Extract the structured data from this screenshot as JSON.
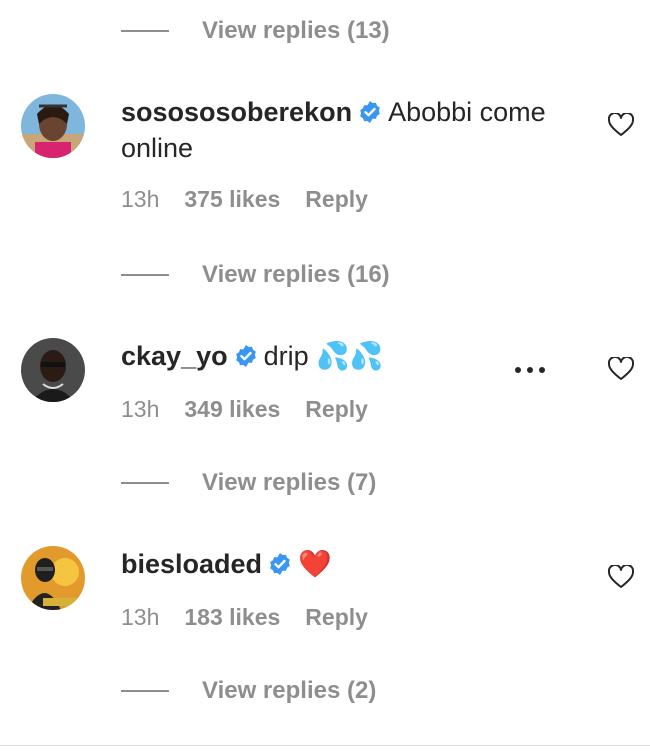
{
  "top_view_replies": {
    "label": "View replies (13)"
  },
  "comments": [
    {
      "username": "sosososoberekon",
      "text": "Abobbi come online",
      "time": "13h",
      "likes": "375 likes",
      "reply_label": "Reply",
      "view_replies": "View replies (16)"
    },
    {
      "username": "ckay_yo",
      "text": "drip 💦💦",
      "time": "13h",
      "likes": "349 likes",
      "reply_label": "Reply",
      "view_replies": "View replies (7)",
      "more_icon": "more-options-icon"
    },
    {
      "username": "biesloaded",
      "text": "❤️",
      "time": "13h",
      "likes": "183 likes",
      "reply_label": "Reply",
      "view_replies": "View replies (2)"
    }
  ],
  "icons": {
    "verified": "verified-badge-icon",
    "like": "heart-outline-icon"
  },
  "colors": {
    "verified": "#3897f0",
    "muted": "#8e8e8e",
    "text": "#262626",
    "heart_red": "#ed1c24"
  }
}
